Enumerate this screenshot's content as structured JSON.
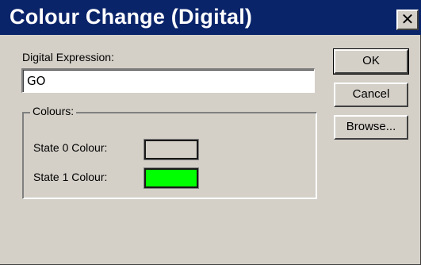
{
  "window": {
    "title": "Colour Change (Digital)",
    "close_glyph": "✕",
    "colors": {
      "title_bar": "#0a246a",
      "face": "#d4d0c8"
    }
  },
  "form": {
    "expression_label": "Digital Expression:",
    "expression_value": "GO",
    "colours_group_label": "Colours:",
    "state0_label": "State 0 Colour:",
    "state0_color": "#d4d0c8",
    "state1_label": "State 1 Colour:",
    "state1_color": "#00ff00"
  },
  "buttons": {
    "ok": "OK",
    "cancel": "Cancel",
    "browse": "Browse..."
  }
}
